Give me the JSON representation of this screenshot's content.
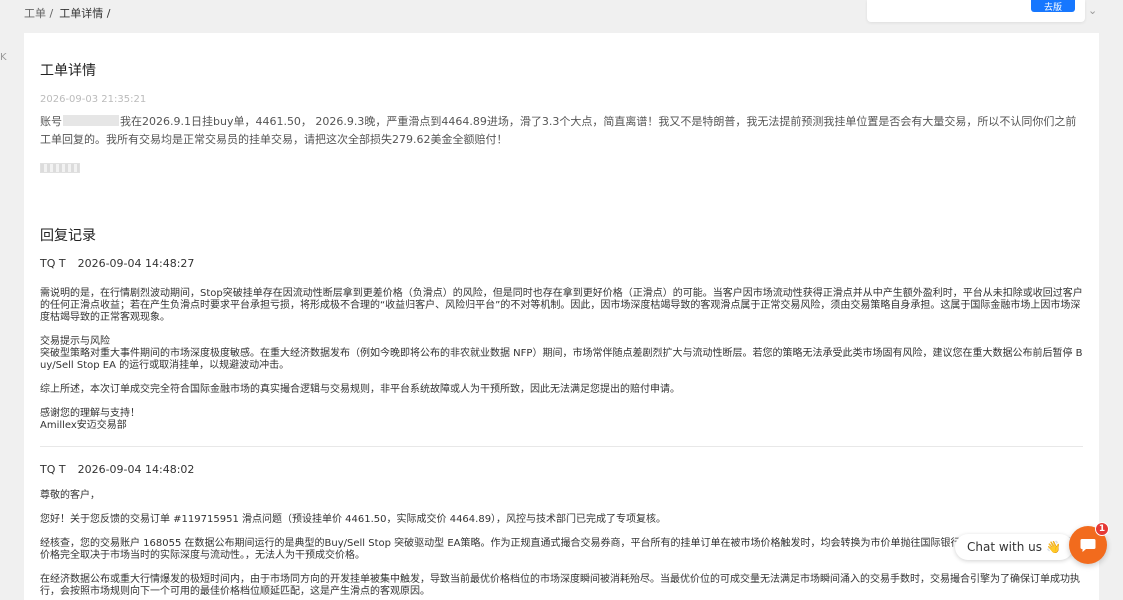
{
  "breadcrumb": {
    "root": "工单 /",
    "current": "工单详情 /"
  },
  "edge_mark": "K",
  "topbar": {
    "button_label": "去版",
    "chevron": "⌄"
  },
  "ticket": {
    "title": "工单详情",
    "time": "2026-09-03 21:35:21",
    "body_prefix": "账号",
    "body_main": "我在2026.9.1日挂buy单，4461.50， 2026.9.3晚，严重滑点到4464.89进场，滑了3.3个大点，简直离谱！我又不是特朗普，我无法提前预测我挂单位置是否会有大量交易，所以不认同你们之前工单回复的。我所有交易均是正常交易员的挂单交易，请把这次全部损失279.62美金全额赔付！"
  },
  "replies_title": "回复记录",
  "replies": [
    {
      "author": "TQ T",
      "time": "2026-09-04 14:48:27",
      "paragraphs": [
        "需说明的是，在行情剧烈波动期间，Stop突破挂单存在因流动性断层拿到更差价格（负滑点）的风险，但是同时也存在拿到更好价格（正滑点）的可能。当客户因市场流动性获得正滑点并从中产生额外盈利时，平台从未扣除或收回过客户的任何正滑点收益；若在产生负滑点时要求平台承担亏损，将形成极不合理的“收益归客户、风险归平台”的不对等机制。因此，因市场深度枯竭导致的客观滑点属于正常交易风险，须由交易策略自身承担。这属于国际金融市场上因市场深度枯竭导致的正常客观现象。",
        "交易提示与风险\n突破型策略对重大事件期间的市场深度极度敏感。在重大经济数据发布（例如今晚即将公布的非农就业数据 NFP）期间，市场常伴随点差剧烈扩大与流动性断层。若您的策略无法承受此类市场固有风险，建议您在重大数据公布前后暂停 Buy/Sell Stop EA 的运行或取消挂单，以规避波动冲击。",
        "综上所述，本次订单成交完全符合国际金融市场的真实撮合逻辑与交易规则，非平台系统故障或人为干预所致，因此无法满足您提出的赔付申请。",
        "感谢您的理解与支持！\nAmillex安迈交易部"
      ]
    },
    {
      "author": "TQ T",
      "time": "2026-09-04 14:48:02",
      "paragraphs": [
        "尊敬的客户，",
        "您好！关于您反馈的交易订单 #119715951 滑点问题（预设挂单价 4461.50，实际成交价 4464.89），风控与技术部门已完成了专项复核。",
        "经核查，您的交易账户 168055 在数据公布期间运行的是典型的Buy/Sell Stop 突破驱动型 EA策略。作为正规直通式撮合交易券商，平台所有的挂单订单在被市场价格触发时，均会转换为市价单抛往国际银行间流动性池进行撮合，撮合价格完全取决于市场当时的实际深度与流动性。，无法人为干预成交价格。",
        "在经济数据公布或重大行情爆发的极短时间内，由于市场同方向的开发挂单被集中触发，导致当前最优价格档位的市场深度瞬间被消耗殆尽。当最优价位的可成交量无法满足市场瞬间涌入的交易手数时，交易撮合引擎为了确保订单成功执行，会按照市场规则向下一个可用的最佳价格档位顺延匹配，这是产生滑点的客观原因。"
      ]
    }
  ],
  "chat": {
    "label": "Chat with us",
    "emoji": "👋",
    "badge": "1"
  }
}
